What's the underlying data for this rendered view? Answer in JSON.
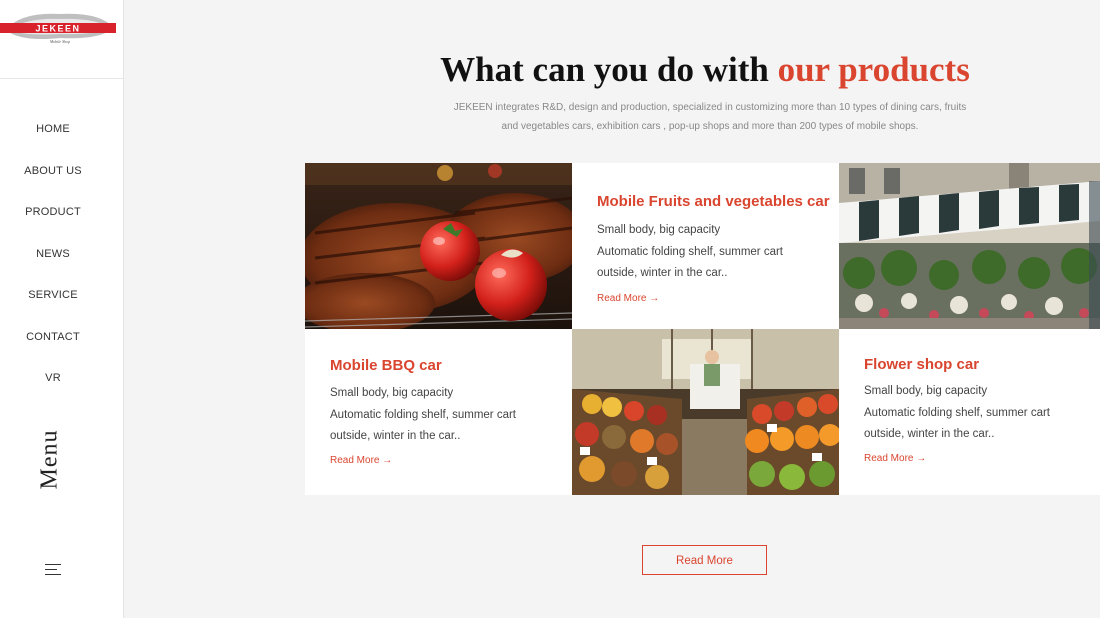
{
  "brand": {
    "logo_text": "JEKEEN",
    "logo_tagline": "Mobile Shop",
    "accent_color": "#d9452f"
  },
  "nav": {
    "items": [
      {
        "label": "HOME"
      },
      {
        "label": "ABOUT US"
      },
      {
        "label": "PRODUCT"
      },
      {
        "label": "NEWS"
      },
      {
        "label": "SERVICE"
      },
      {
        "label": "CONTACT"
      },
      {
        "label": "VR"
      }
    ],
    "menu_label": "Menu"
  },
  "section": {
    "title_main": "What can you do with ",
    "title_accent": "our products",
    "subtitle_line1": "JEKEEN integrates R&D, design and production, specialized in customizing more than 10 types of dining cars, fruits",
    "subtitle_line2": "and vegetables cars, exhibition cars , pop-up shops and more than 200 types of mobile shops."
  },
  "products": [
    {
      "title": "Mobile BBQ car",
      "line1": "Small body, big capacity",
      "line2": "Automatic folding shelf, summer cart",
      "line3": "outside, winter in the car..",
      "link": "Read More →",
      "image": "bbq-grill-with-meat-and-tomatoes"
    },
    {
      "title": "Mobile Fruits and vegetables car",
      "line1": "Small body, big capacity",
      "line2": "Automatic folding shelf, summer cart",
      "line3": "outside, winter in the car..",
      "link": "Read More →",
      "image": "fruit-and-vegetable-market-stand"
    },
    {
      "title": "Flower shop car",
      "line1": "Small body, big capacity",
      "line2": "Automatic folding shelf, summer cart",
      "line3": "outside, winter in the car..",
      "link": "Read More →",
      "image": "flower-shop-with-striped-awnings"
    }
  ],
  "cta": {
    "label": "Read More"
  }
}
